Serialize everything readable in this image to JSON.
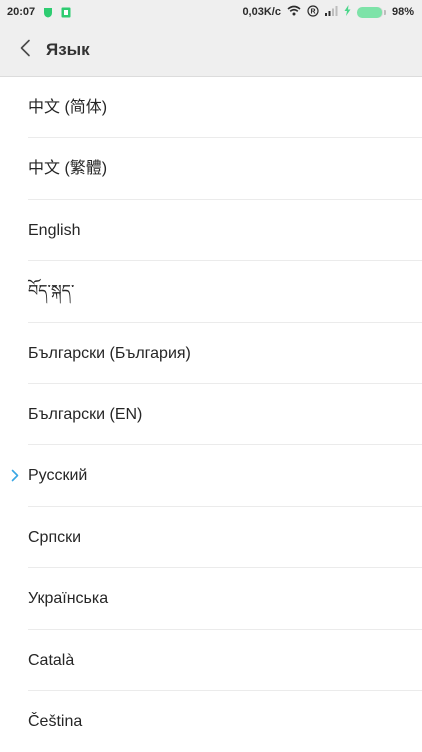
{
  "status_bar": {
    "time": "20:07",
    "speed": "0,03K/c",
    "roaming": "R",
    "battery_percent_label": "98%",
    "battery_level": 0.98,
    "notification_colors": [
      "#2ecc71",
      "#2ecc71"
    ]
  },
  "header": {
    "title": "Язык"
  },
  "languages": [
    {
      "label": "中文 (简体)",
      "selected": false
    },
    {
      "label": "中文 (繁體)",
      "selected": false
    },
    {
      "label": "English",
      "selected": false
    },
    {
      "label": "བོད་སྐད་",
      "selected": false
    },
    {
      "label": "Български (България)",
      "selected": false
    },
    {
      "label": "Български (EN)",
      "selected": false
    },
    {
      "label": "Русский",
      "selected": true
    },
    {
      "label": "Српски",
      "selected": false
    },
    {
      "label": "Українська",
      "selected": false
    },
    {
      "label": "Català",
      "selected": false
    },
    {
      "label": "Čeština",
      "selected": false
    }
  ],
  "colors": {
    "accent": "#3aa7e4",
    "bar_background": "#efefef",
    "battery_fill": "#7de3a8"
  },
  "icons": {
    "back": "chevron-left-icon",
    "selected": "chevron-right-icon",
    "wifi": "wifi-icon",
    "signal": "signal-icon",
    "charging": "bolt-icon"
  }
}
